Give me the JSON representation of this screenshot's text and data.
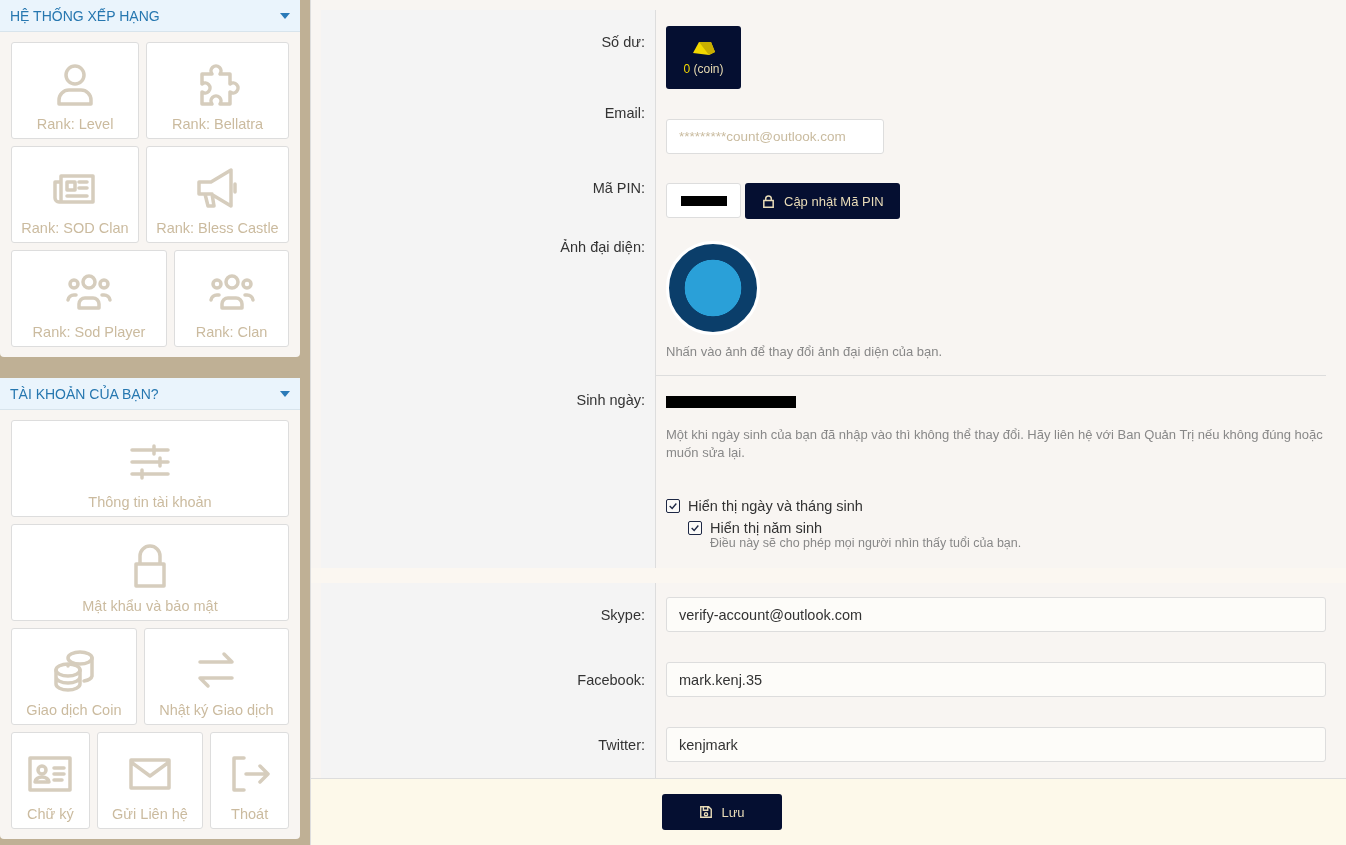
{
  "sidebar": {
    "panels": [
      {
        "title": "HỆ THỐNG XẾP HẠNG",
        "expanded": true,
        "rows": [
          [
            {
              "label": "Rank: Level",
              "kind": "user"
            },
            {
              "label": "Rank: Bellatra",
              "kind": "puzzle"
            }
          ],
          [
            {
              "label": "Rank: SOD Clan",
              "kind": "newspaper"
            },
            {
              "label": "Rank: Bless Castle",
              "kind": "megaphone"
            }
          ],
          [
            {
              "label": "Rank: Sod Player",
              "kind": "users"
            },
            {
              "label": "Rank: Clan",
              "kind": "users"
            }
          ]
        ]
      },
      {
        "title": "TÀI KHOẢN CỦA BẠN?",
        "expanded": true,
        "rows": [
          [
            {
              "label": "Thông tin tài khoản",
              "kind": "sliders"
            }
          ],
          [
            {
              "label": "Mật khẩu và bảo mật",
              "kind": "lock"
            }
          ],
          [
            {
              "label": "Giao dịch Coin",
              "kind": "coins"
            },
            {
              "label": "Nhật ký Giao dịch",
              "kind": "arrows"
            }
          ],
          [
            {
              "label": "Chữ ký",
              "kind": "idcard"
            },
            {
              "label": "Gửi Liên hệ",
              "kind": "envelope"
            },
            {
              "label": "Thoát",
              "kind": "logout"
            }
          ]
        ]
      }
    ]
  },
  "form": {
    "balance": {
      "label": "Số dư:",
      "amount": "0",
      "unit": "(coin)"
    },
    "email": {
      "label": "Email:",
      "value": "*********count@outlook.com"
    },
    "pin": {
      "label": "Mã PIN:",
      "button": "Cập nhật Mã PIN"
    },
    "avatar": {
      "label": "Ảnh đại diện:",
      "hint": "Nhấn vào ảnh để thay đổi ảnh đại diện của bạn."
    },
    "birthday": {
      "label": "Sinh ngày:",
      "note": "Một khi ngày sinh của bạn đã nhập vào thì không thể thay đổi. Hãy liên hệ với Ban Quản Trị nếu không đúng hoặc muốn sửa lại.",
      "options": [
        {
          "label": "Hiển thị ngày và tháng sinh",
          "checked": true,
          "children": [
            {
              "label": "Hiển thị năm sinh",
              "checked": true,
              "note": "Điều này sẽ cho phép mọi người nhìn thấy tuổi của bạn."
            }
          ]
        }
      ]
    },
    "social": [
      {
        "label": "Skype:",
        "value": "verify-account@outlook.com"
      },
      {
        "label": "Facebook:",
        "value": "mark.kenj.35"
      },
      {
        "label": "Twitter:",
        "value": "kenjmark"
      }
    ],
    "save_button": "Lưu"
  }
}
